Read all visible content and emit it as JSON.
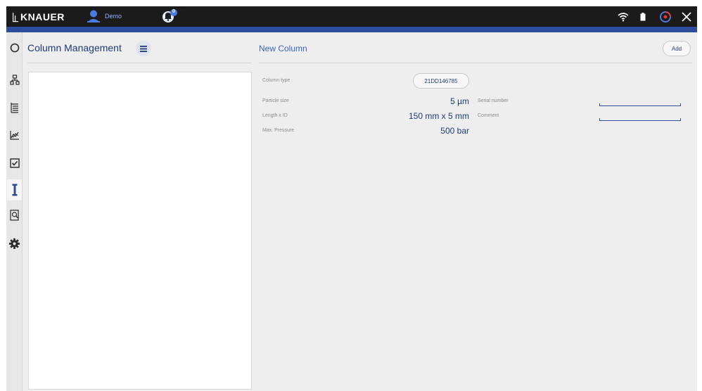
{
  "header": {
    "brand": "KNAUER",
    "user_label": "Demo",
    "notification_count": "0"
  },
  "sidebar": {
    "items": [
      {
        "icon": "circle-status-icon"
      },
      {
        "icon": "flow-diagram-icon"
      },
      {
        "icon": "list-tree-icon"
      },
      {
        "icon": "chart-icon"
      },
      {
        "icon": "checkbox-icon"
      },
      {
        "icon": "column-icon",
        "active": true
      },
      {
        "icon": "search-document-icon"
      },
      {
        "icon": "gear-icon"
      }
    ]
  },
  "left_panel": {
    "title": "Column Management"
  },
  "right_panel": {
    "title": "New Column",
    "add_label": "Add",
    "fields": {
      "column_type_label": "Column type",
      "column_type_value": "21DD146785",
      "particle_size_label": "Particle size",
      "particle_size_value": "5 µm",
      "length_id_label": "Length x ID",
      "length_id_value": "150 mm x 5 mm",
      "max_pressure_label": "Max. Pressure",
      "max_pressure_value": "500 bar",
      "serial_number_label": "Serial number",
      "serial_number_value": "",
      "comment_label": "Comment",
      "comment_value": ""
    }
  },
  "colors": {
    "topbar": "#1b1b1b",
    "accent_bar": "#2d4d9c",
    "text_primary": "#1f3a78",
    "title_blue": "#3a63c4"
  }
}
